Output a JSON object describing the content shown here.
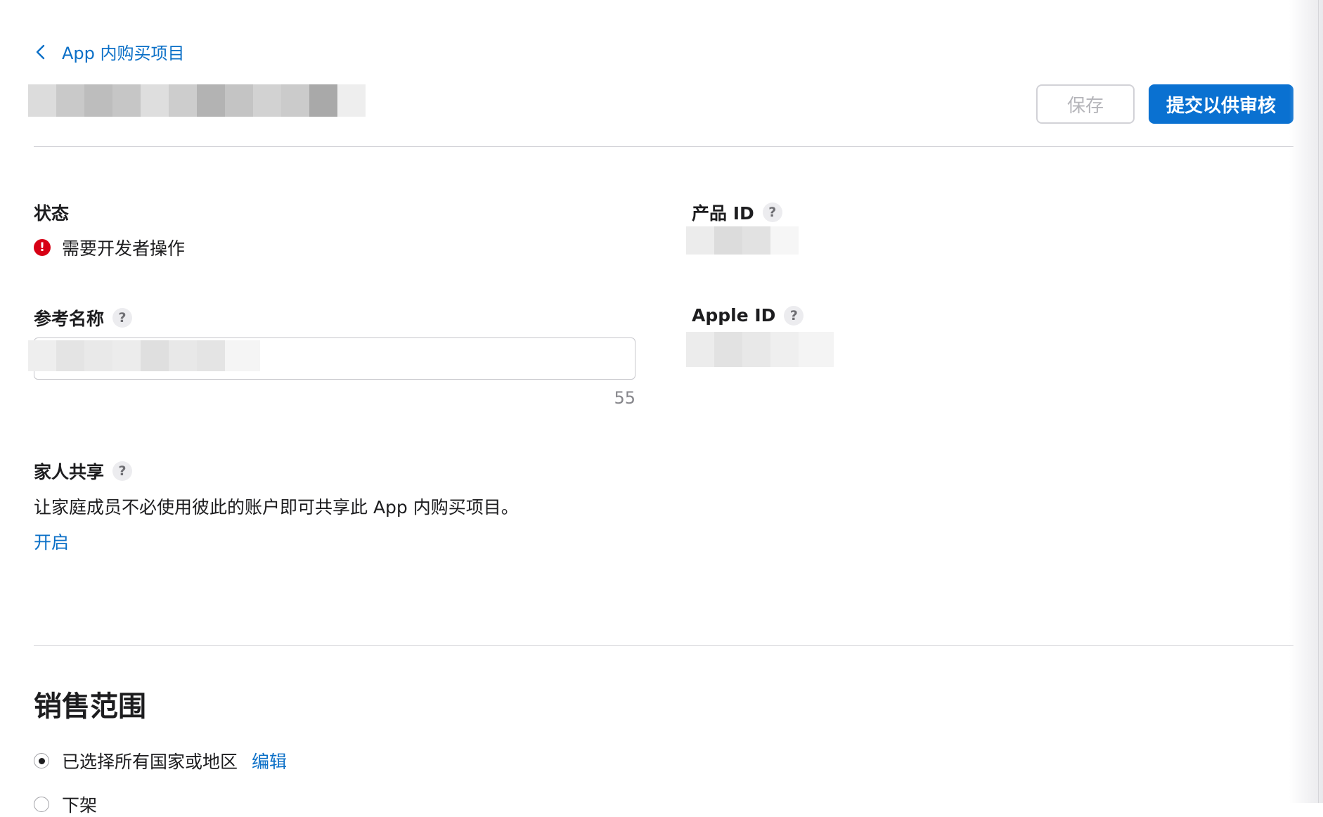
{
  "nav": {
    "back_label": "App 内购买项目"
  },
  "toolbar": {
    "save_label": "保存",
    "submit_label": "提交以供审核"
  },
  "fields": {
    "status": {
      "label": "状态",
      "value": "需要开发者操作",
      "icon_glyph": "!"
    },
    "product_id": {
      "label": "产品 ID",
      "help": "?"
    },
    "reference_name": {
      "label": "参考名称",
      "help": "?",
      "char_count": "55"
    },
    "apple_id": {
      "label": "Apple ID",
      "help": "?"
    }
  },
  "family_sharing": {
    "label": "家人共享",
    "help": "?",
    "description": "让家庭成员不必使用彼此的账户即可共享此 App 内购买项目。",
    "action": "开启"
  },
  "availability": {
    "title": "销售范围",
    "options": [
      {
        "label": "已选择所有国家或地区",
        "selected": true,
        "edit": "编辑"
      },
      {
        "label": "下架",
        "selected": false
      }
    ]
  },
  "colors": {
    "accent": "#0a71d1",
    "link": "#0a6fc7",
    "error": "#d70015"
  },
  "icons": {
    "back": "chevron-left-icon",
    "status": "error-icon",
    "help": "question-icon"
  }
}
